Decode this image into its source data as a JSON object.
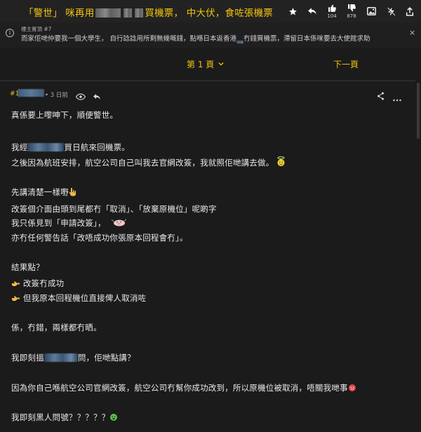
{
  "thread": {
    "title_prefix": "「警世」 咪再用",
    "title_suffix": "買機票， 中大伏，食咗張機票"
  },
  "toolbar": {
    "like_count": "104",
    "dislike_count": "878"
  },
  "pinned": {
    "label": "樓主置頂",
    "ref": "#7",
    "text_before": "而家佢哋仲要我一個大學生， 自行諗諗用所剩無幾嘅錢，點喺日本返香港",
    "text_after": "冇錢買機票，滯留日本係咪要去大使館求助",
    "close_label": "×"
  },
  "pager": {
    "current_page": "第 1 頁",
    "next_page": "下一頁"
  },
  "post": {
    "number": "#1",
    "time": "• 3 日前",
    "lines": {
      "l1": "真係要上嚟呻下，順便警世。",
      "l2_before": "我經",
      "l2_after": "買日航來回機票。",
      "l3": "之後因為航班安排，航空公司自己叫我去官網改簽，我就照佢哋講去做。",
      "l4": "先講清楚一樣嘢",
      "l5": "改簽個介面由頭到尾都冇「取消」、「放棄原機位」呢啲字",
      "l6": "我只係見到「申請改簽」，",
      "l7": "亦冇任何警告話「改唔成功你張原本回程會冇」。",
      "l8": "結果點？",
      "l9": "改簽冇成功",
      "l10": "但我原本回程機位直接俾人取消咗",
      "l11": "係，冇錯，兩樣都冇晒。",
      "l12_before": "我即刻搵",
      "l12_after": "問，佢哋點講？",
      "l13": "因為你自己喺航空公司官網改簽，航空公司冇幫你成功改到，所以原機位被取消，唔關我哋事",
      "l14": "我即刻黑人問號？？？？？"
    }
  },
  "colors": {
    "accent": "#f2c40e",
    "background": "#1b1b1b",
    "text": "#e8e8e8"
  },
  "icons": [
    "star-icon",
    "reply-icon",
    "thumbs-up-icon",
    "thumbs-down-icon",
    "image-icon",
    "lightning-icon",
    "share-icon",
    "info-icon",
    "eye-icon",
    "more-icon"
  ]
}
